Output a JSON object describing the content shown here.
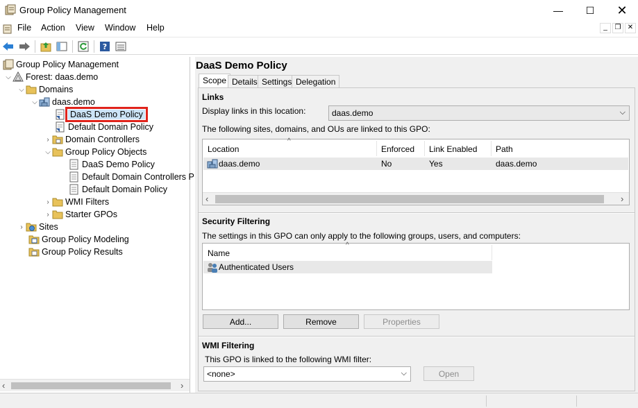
{
  "window": {
    "title": "Group Policy Management"
  },
  "menu": [
    "File",
    "Action",
    "View",
    "Window",
    "Help"
  ],
  "tree": {
    "root": "Group Policy Management",
    "forest": "Forest: daas.demo",
    "domains": "Domains",
    "domain": "daas.demo",
    "items": {
      "daas_policy": "DaaS Demo Policy",
      "default_domain_policy": "Default Domain Policy",
      "domain_controllers": "Domain Controllers",
      "gpo": "Group Policy Objects",
      "gpo_daas": "DaaS Demo Policy",
      "gpo_ddcp": "Default Domain Controllers P",
      "gpo_ddp": "Default Domain Policy",
      "wmi": "WMI Filters",
      "starter": "Starter GPOs",
      "sites": "Sites",
      "modeling": "Group Policy Modeling",
      "results": "Group Policy Results"
    }
  },
  "right": {
    "title": "DaaS Demo Policy",
    "tabs": [
      "Scope",
      "Details",
      "Settings",
      "Delegation"
    ],
    "links": {
      "heading": "Links",
      "display_label": "Display links in this location:",
      "display_value": "daas.demo",
      "desc": "The following sites, domains, and OUs are linked to this GPO:",
      "columns": [
        "Location",
        "Enforced",
        "Link Enabled",
        "Path"
      ],
      "rows": [
        {
          "location": "daas.demo",
          "enforced": "No",
          "link_enabled": "Yes",
          "path": "daas.demo"
        }
      ]
    },
    "security": {
      "heading": "Security Filtering",
      "desc": "The settings in this GPO can only apply to the following groups, users, and computers:",
      "column": "Name",
      "rows": [
        "Authenticated Users"
      ],
      "add": "Add...",
      "remove": "Remove",
      "properties": "Properties"
    },
    "wmi": {
      "heading": "WMI Filtering",
      "desc": "This GPO is linked to the following WMI filter:",
      "value": "<none>",
      "open": "Open"
    }
  },
  "colors": {
    "highlight": "#e0231b",
    "selection": "#cce4f7"
  }
}
